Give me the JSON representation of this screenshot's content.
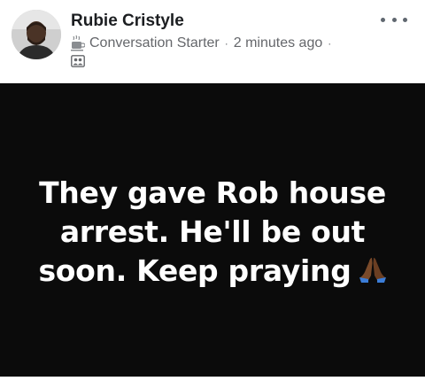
{
  "post": {
    "author": "Rubie Cristyle",
    "badge": "Conversation Starter",
    "separator": "·",
    "timestamp": "2 minutes ago",
    "audience_icon": "group-icon",
    "more_icon": "more-options-icon",
    "text_lines": [
      "They gave Rob house",
      "arrest. He'll be out",
      "soon. Keep praying"
    ],
    "emoji": "folded-hands-emoji"
  },
  "colors": {
    "post_background": "#0b0b0b",
    "post_text": "#ffffff",
    "meta_text": "#65676b",
    "author_text": "#1c1e21"
  }
}
